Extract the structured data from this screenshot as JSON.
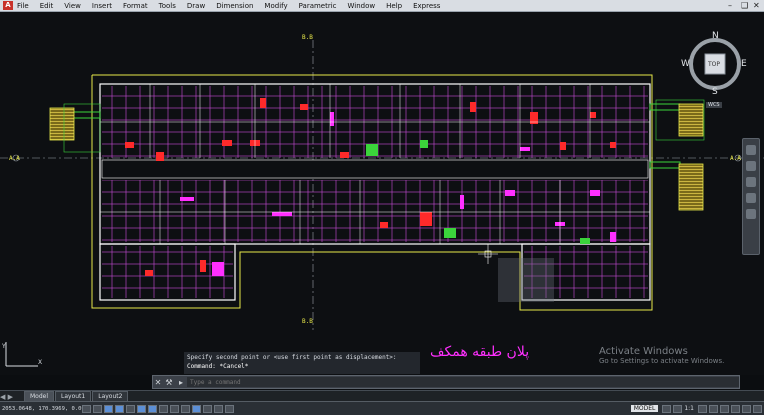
{
  "app": {
    "logo_letter": "A"
  },
  "menu": {
    "items": [
      "File",
      "Edit",
      "View",
      "Insert",
      "Format",
      "Tools",
      "Draw",
      "Dimension",
      "Modify",
      "Parametric",
      "Window",
      "Help",
      "Express"
    ]
  },
  "viewcube": {
    "north": "N",
    "south": "S",
    "east": "E",
    "west": "W",
    "face": "TOP",
    "wcs": "WCS"
  },
  "grid_labels": {
    "top": "B.B",
    "bottom": "B.B",
    "left": "A.A",
    "right": "A.A"
  },
  "drawing_title": "پلان طبقه همکف",
  "command": {
    "history_line1": "Specify second point or <use first point as displacement>:",
    "history_line2": "Command: *Cancel*",
    "placeholder": "Type a command"
  },
  "layout_tabs": [
    "Model",
    "Layout1",
    "Layout2"
  ],
  "status": {
    "coords": "2053.0648, 170.3969, 0.0000",
    "model": "MODEL",
    "scale": "1:1"
  },
  "watermark": {
    "line1": "Activate Windows",
    "line2": "Go to Settings to activate Windows."
  },
  "colors": {
    "accent_yellow": "#e8e84a",
    "wall_magenta": "#ff2fff",
    "wall_red": "#ff2a2a",
    "hatch_green": "#3bd43b",
    "stair_yellow": "#d6c23a"
  }
}
